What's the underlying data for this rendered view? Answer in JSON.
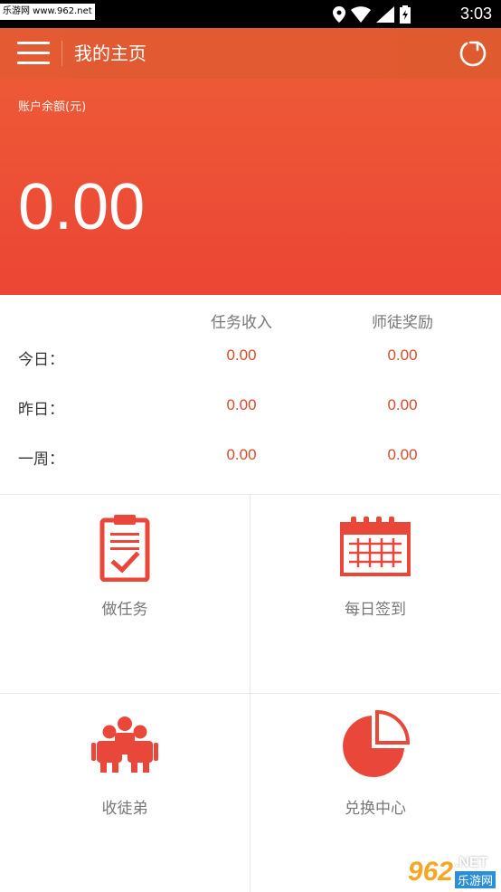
{
  "statusbar": {
    "watermark": "乐游网 www.962.net",
    "time": "3:03"
  },
  "appbar": {
    "title": "我的主页",
    "icons": [
      "menu-icon",
      "refresh-icon"
    ]
  },
  "balance": {
    "label": "账户余额(元)",
    "value": "0.00"
  },
  "stats": {
    "headers": [
      "任务收入",
      "师徒奖励"
    ],
    "rows": [
      {
        "label": "今日：",
        "task": "0.00",
        "reward": "0.00"
      },
      {
        "label": "昨日：",
        "task": "0.00",
        "reward": "0.00"
      },
      {
        "label": "一周：",
        "task": "0.00",
        "reward": "0.00"
      }
    ]
  },
  "grid": {
    "items": [
      {
        "label": "做任务",
        "icon": "clipboard-check-icon"
      },
      {
        "label": "每日签到",
        "icon": "calendar-icon"
      },
      {
        "label": "收徒弟",
        "icon": "people-icon"
      },
      {
        "label": "兑换中心",
        "icon": "pie-chart-icon"
      }
    ]
  },
  "watermark_br": {
    "num": "962",
    "net": ".NET",
    "cn": "乐游网"
  },
  "colors": {
    "accent": "#ec4535",
    "appbar": "#e05a30",
    "value_red": "#d94a2b",
    "icon_red": "#e8473a"
  }
}
